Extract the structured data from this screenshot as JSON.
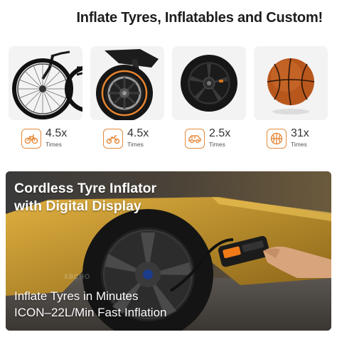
{
  "headline": "Inflate Tyres, Inflatables and Custom!",
  "categories": [
    {
      "name": "bicycle",
      "icon": "bicycle-icon",
      "value": "4.5x",
      "unit": "Times"
    },
    {
      "name": "motorcycle",
      "icon": "motorcycle-icon",
      "value": "4.5x",
      "unit": "Times"
    },
    {
      "name": "car",
      "icon": "car-icon",
      "value": "2.5x",
      "unit": "Times"
    },
    {
      "name": "basketball",
      "icon": "basketball-icon",
      "value": "31x",
      "unit": "Times"
    }
  ],
  "hero": {
    "title_line1": "Cordless Tyre Inflator",
    "title_line2": "with Digital Display",
    "sub_line1": "Inflate Tyres in Minutes",
    "sub_line2": "ICON–22L/Min Fast Inflation",
    "watermark": "XBCHO"
  },
  "colors": {
    "accent": "#e58a3b",
    "card_bg": "#f4f4f4",
    "car_yellow": "#c99a2e",
    "hero_bg": "#2a2a2a"
  }
}
